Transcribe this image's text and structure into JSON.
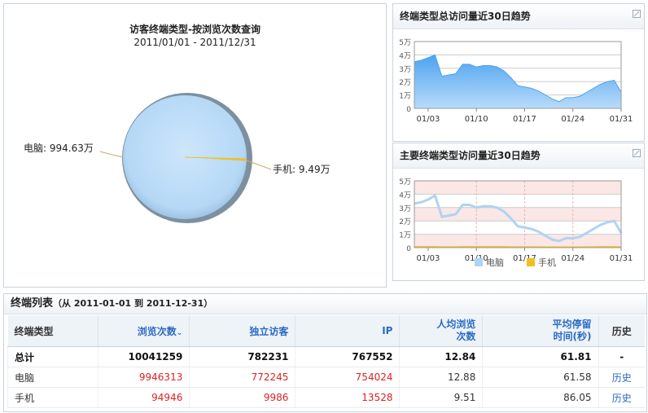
{
  "pie": {
    "title": "访客终端类型-按浏览次数查询",
    "subtitle": "2011/01/01 - 2011/12/31",
    "slices": [
      {
        "label": "电脑: 994.63万",
        "value": 994.63,
        "color": "#b9d9f7"
      },
      {
        "label": "手机: 9.49万",
        "value": 9.49,
        "color": "#f0c020"
      }
    ]
  },
  "trend_total": {
    "title": "终端类型总访问量近30日趋势",
    "chart_data": {
      "type": "area",
      "y_ticks": [
        "5万",
        "4万",
        "3万",
        "2万",
        "1万",
        "0"
      ],
      "x_ticks": [
        "01/03",
        "01/10",
        "01/17",
        "01/24",
        "01/31"
      ],
      "ylim": [
        0,
        5
      ],
      "series": [
        {
          "values": [
            3.5,
            3.6,
            3.8,
            4.0,
            2.4,
            2.5,
            2.6,
            3.3,
            3.3,
            3.1,
            3.2,
            3.2,
            3.1,
            2.8,
            2.3,
            1.7,
            1.6,
            1.5,
            1.3,
            1.0,
            0.7,
            0.5,
            0.8,
            0.8,
            0.9,
            1.2,
            1.5,
            1.8,
            2.0,
            2.1,
            1.2
          ],
          "color": "#5aaaf0"
        }
      ]
    }
  },
  "trend_type": {
    "title": "主要终端类型访问量近30日趋势",
    "chart_data": {
      "type": "line",
      "y_ticks": [
        "5万",
        "4万",
        "3万",
        "2万",
        "1万",
        "0"
      ],
      "x_ticks": [
        "01/03",
        "01/10",
        "01/17",
        "01/24",
        "01/31"
      ],
      "ylim": [
        0,
        5
      ],
      "series": [
        {
          "name": "电脑",
          "color": "#b0d3f3",
          "values": [
            3.3,
            3.4,
            3.6,
            3.9,
            2.3,
            2.4,
            2.5,
            3.2,
            3.2,
            3.0,
            3.1,
            3.1,
            3.0,
            2.7,
            2.2,
            1.6,
            1.5,
            1.4,
            1.2,
            0.9,
            0.6,
            0.5,
            0.7,
            0.7,
            0.8,
            1.1,
            1.4,
            1.7,
            1.9,
            2.0,
            1.1
          ]
        },
        {
          "name": "手机",
          "color": "#f0c020",
          "values": [
            0.05,
            0.05,
            0.05,
            0.05,
            0.04,
            0.04,
            0.04,
            0.05,
            0.05,
            0.05,
            0.05,
            0.05,
            0.05,
            0.05,
            0.04,
            0.04,
            0.04,
            0.04,
            0.04,
            0.03,
            0.03,
            0.03,
            0.03,
            0.03,
            0.03,
            0.04,
            0.04,
            0.05,
            0.05,
            0.05,
            0.04
          ]
        }
      ]
    }
  },
  "table": {
    "title": "终端列表",
    "range": "（从 2011-01-01 到 2011-12-31）",
    "headers": {
      "type": "终端类型",
      "pv": "浏览次数",
      "uv": "独立访客",
      "ip": "IP",
      "avg_pv_1": "人均浏览",
      "avg_pv_2": "次数",
      "avg_time_1": "平均停留",
      "avg_time_2": "时间(秒)",
      "history": "历史"
    },
    "rows": [
      {
        "name": "总计",
        "pv": "10041259",
        "uv": "782231",
        "ip": "767552",
        "avg_pv": "12.84",
        "avg_time": "61.81",
        "history": "-"
      },
      {
        "name": "电脑",
        "pv": "9946313",
        "uv": "772245",
        "ip": "754024",
        "avg_pv": "12.88",
        "avg_time": "61.58",
        "history": "历史"
      },
      {
        "name": "手机",
        "pv": "94946",
        "uv": "9986",
        "ip": "13528",
        "avg_pv": "9.51",
        "avg_time": "86.05",
        "history": "历史"
      }
    ]
  }
}
